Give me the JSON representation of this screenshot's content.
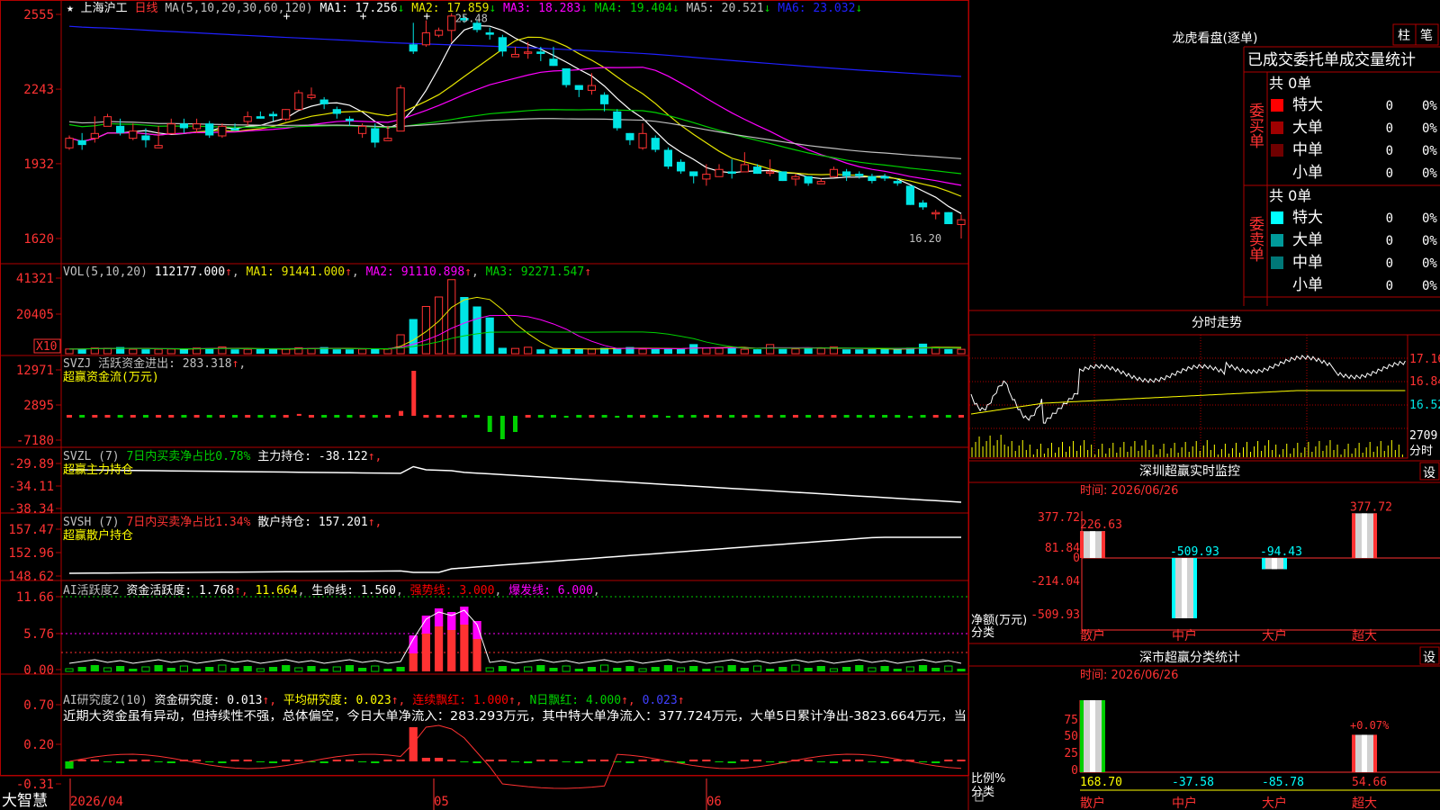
{
  "colors": {
    "bg": "#000000",
    "grid": "#b00000",
    "up": "#ff3232",
    "down": "#00e5e5",
    "green": "#00d000",
    "ma1": "#ffffff",
    "ma2": "#e6e600",
    "ma3": "#ff00ff",
    "ma4": "#00d000",
    "ma5": "#c0c0c0",
    "ma6": "#2020ff",
    "label": "#c0c0c0",
    "yellow": "#ffff00",
    "red": "#ff0000",
    "magenta": "#ff00ff",
    "cyan": "#00ffff"
  },
  "main": {
    "stock_name": "上海沪工",
    "period": "日线",
    "ma_params": "MA(5,10,20,30,60,120)",
    "ma_values": [
      {
        "label": "MA1: 17.256",
        "arrow": "↓"
      },
      {
        "label": "MA2: 17.859",
        "arrow": "↓"
      },
      {
        "label": "MA3: 18.283",
        "arrow": "↓"
      },
      {
        "label": "MA4: 19.404",
        "arrow": "↓"
      },
      {
        "label": "MA5: 20.521",
        "arrow": "↓"
      },
      {
        "label": "MA6: 23.032",
        "arrow": "↓"
      }
    ],
    "y_ticks": [
      "2555",
      "2243",
      "1932",
      "1620"
    ],
    "high_marker": "25.48",
    "low_marker": "16.20"
  },
  "vol": {
    "header": "VOL(5,10,20)",
    "value": "112177.000",
    "ma": [
      {
        "label": "MA1: 91441.000"
      },
      {
        "label": "MA2: 91110.898"
      },
      {
        "label": "MA3: 92271.547"
      }
    ],
    "y_ticks": [
      "41321",
      "20405"
    ],
    "unit": "X10"
  },
  "svzj": {
    "header": "SVZJ",
    "item": "活跃资金进出: 283.318",
    "sub": "超赢资金流(万元)",
    "y_ticks": [
      "12971",
      "2895",
      "-7180"
    ]
  },
  "svzl": {
    "header": "SVZL (7)",
    "ratio": "7日内买卖净占比0.78%",
    "item": "主力持仓: -38.122",
    "sub": "超赢主力持仓",
    "y_ticks": [
      "-29.89",
      "-34.11",
      "-38.34"
    ]
  },
  "svsh": {
    "header": "SVSH (7)",
    "ratio": "7日内买卖净占比1.34%",
    "item": "散户持仓: 157.201",
    "sub": "超赢散户持仓",
    "y_ticks": [
      "157.47",
      "152.96",
      "148.62"
    ]
  },
  "ai_active": {
    "header": "AI活跃度2",
    "item1": "资金活跃度: 1.768",
    "item2": "11.664",
    "item3": "生命线: 1.560",
    "item4": "强势线: 3.000",
    "item5": "爆发线: 6.000",
    "y_ticks": [
      "11.66",
      "5.76",
      "0.00"
    ]
  },
  "ai_research": {
    "header": "AI研究度2(10)",
    "item1": "资金研究度: 0.013",
    "item2": "平均研究度: 0.023",
    "item3": "连续飘红: 1.000",
    "item4": "N日飘红: 4.000",
    "item5": "0.023",
    "comment": "近期大资金虽有异动，但持续性不强，总体偏空，今日大单净流入：283.293万元，其中特大单净流入：377.724万元，大单5日累计净出-3823.664万元，当",
    "y_ticks": [
      "0.70",
      "0.20",
      "-0.31"
    ]
  },
  "footer": {
    "brand": "大智慧",
    "dates": [
      "2026/04",
      "05",
      "06"
    ]
  },
  "right_panel": {
    "title": "龙虎看盘(逐单)",
    "btn_zhu": "柱",
    "btn_bi": "笔",
    "table_title": "已成交委托单成交量统计",
    "buy_label": "委买单",
    "sell_label": "委卖单",
    "buy_total": "共 0单",
    "sell_total": "共 0单",
    "buy_rows": [
      {
        "name": "特大",
        "count": "0",
        "pct": "0%",
        "color": "#ff0000"
      },
      {
        "name": "大单",
        "count": "0",
        "pct": "0%",
        "color": "#a00000"
      },
      {
        "name": "中单",
        "count": "0",
        "pct": "0%",
        "color": "#700000"
      },
      {
        "name": "小单",
        "count": "0",
        "pct": "0%",
        "color": ""
      }
    ],
    "sell_rows": [
      {
        "name": "特大",
        "count": "0",
        "pct": "0%",
        "color": "#00ffff"
      },
      {
        "name": "大单",
        "count": "0",
        "pct": "0%",
        "color": "#009a9a"
      },
      {
        "name": "中单",
        "count": "0",
        "pct": "0%",
        "color": "#007878"
      },
      {
        "name": "小单",
        "count": "0",
        "pct": "0%",
        "color": ""
      }
    ],
    "intraday_title": "分时走势",
    "intraday_ticks": [
      "17.16",
      "16.84",
      "16.52"
    ],
    "intraday_vol": "2709",
    "intraday_vol_label": "分时",
    "monitor_title": "深圳超赢实时监控",
    "monitor_set": "设",
    "monitor_time": "时间: 2026/06/26",
    "monitor_y": [
      "377.72",
      "81.84",
      "0",
      "-214.04",
      "-509.93"
    ],
    "monitor_ylabel1": "净额(万元)",
    "monitor_ylabel2": "分类",
    "monitor_cats": [
      "散户",
      "中户",
      "大户",
      "超大"
    ],
    "monitor_vals": [
      "226.63",
      "-509.93",
      "-94.43",
      "377.72"
    ],
    "stat_title": "深市超赢分类统计",
    "stat_set": "设",
    "stat_time": "时间: 2026/06/26",
    "stat_y": [
      "75",
      "50",
      "25",
      "0"
    ],
    "stat_ylabel1": "比例%",
    "stat_ylabel2": "分类",
    "stat_cats": [
      "散户",
      "中户",
      "大户",
      "超大"
    ],
    "stat_vals": [
      "168.70",
      "-37.58",
      "-85.78",
      "54.66"
    ],
    "stat_top_label": "+0.07%"
  },
  "chart_data": {
    "type": "candlestick",
    "candles": [
      [
        20.0,
        20.4,
        20.5,
        19.9
      ],
      [
        20.3,
        20.1,
        20.6,
        19.9
      ],
      [
        20.4,
        20.6,
        21.3,
        20.2
      ],
      [
        20.9,
        21.3,
        21.4,
        20.9
      ],
      [
        20.9,
        20.6,
        21.2,
        20.5
      ],
      [
        20.4,
        20.7,
        21.0,
        20.3
      ],
      [
        20.5,
        20.3,
        20.8,
        20.0
      ],
      [
        20.0,
        20.1,
        20.9,
        20.0
      ],
      [
        20.6,
        21.0,
        21.2,
        20.6
      ],
      [
        21.0,
        20.8,
        21.2,
        20.6
      ],
      [
        20.8,
        21.0,
        21.2,
        20.6
      ],
      [
        21.0,
        20.5,
        21.1,
        20.4
      ],
      [
        20.5,
        20.9,
        21.0,
        20.4
      ],
      [
        20.8,
        20.7,
        21.0,
        20.7
      ],
      [
        21.1,
        21.3,
        21.5,
        20.9
      ],
      [
        21.3,
        21.2,
        21.5,
        21.2
      ],
      [
        21.4,
        21.3,
        21.5,
        21.1
      ],
      [
        21.2,
        21.6,
        21.6,
        21.1
      ],
      [
        21.6,
        22.3,
        22.4,
        21.6
      ],
      [
        22.1,
        22.2,
        22.5,
        22.0
      ],
      [
        22.0,
        21.8,
        22.1,
        21.6
      ],
      [
        21.6,
        21.4,
        21.7,
        21.2
      ],
      [
        21.2,
        21.1,
        21.3,
        20.9
      ],
      [
        20.6,
        20.9,
        21.0,
        20.4
      ],
      [
        20.8,
        20.2,
        21.0,
        20.0
      ],
      [
        20.3,
        20.4,
        20.9,
        20.3
      ],
      [
        20.7,
        22.5,
        22.6,
        20.7
      ],
      [
        24.3,
        24.0,
        25.2,
        23.9
      ],
      [
        24.3,
        24.8,
        25.3,
        24.2
      ],
      [
        24.7,
        24.9,
        25.0,
        24.6
      ],
      [
        24.9,
        25.5,
        25.6,
        24.4
      ],
      [
        25.4,
        25.3,
        25.5,
        25.2
      ],
      [
        25.2,
        24.9,
        25.3,
        24.8
      ],
      [
        24.8,
        24.7,
        25.0,
        24.5
      ],
      [
        24.6,
        24.0,
        24.7,
        23.8
      ],
      [
        23.8,
        23.9,
        24.2,
        23.8
      ],
      [
        24.0,
        24.0,
        24.4,
        23.7
      ],
      [
        24.0,
        23.9,
        24.2,
        23.6
      ],
      [
        23.7,
        23.4,
        24.2,
        23.4
      ],
      [
        23.3,
        22.6,
        23.3,
        22.5
      ],
      [
        22.6,
        22.4,
        22.6,
        22.1
      ],
      [
        22.4,
        22.6,
        23.1,
        22.2
      ],
      [
        22.2,
        21.8,
        22.3,
        21.5
      ],
      [
        21.5,
        20.8,
        21.6,
        20.7
      ],
      [
        20.6,
        20.3,
        20.6,
        20.1
      ],
      [
        20.0,
        20.6,
        21.0,
        19.9
      ],
      [
        20.4,
        19.9,
        20.5,
        19.8
      ],
      [
        19.9,
        19.2,
        20.0,
        19.1
      ],
      [
        19.4,
        19.0,
        19.5,
        18.9
      ],
      [
        19.0,
        18.8,
        19.0,
        18.5
      ],
      [
        18.7,
        18.9,
        19.3,
        18.4
      ],
      [
        18.8,
        19.1,
        19.3,
        18.8
      ],
      [
        19.0,
        18.9,
        19.5,
        18.7
      ],
      [
        19.0,
        19.3,
        19.8,
        19.0
      ],
      [
        19.2,
        18.9,
        19.3,
        18.9
      ],
      [
        19.0,
        19.0,
        19.5,
        18.8
      ],
      [
        19.0,
        18.6,
        19.0,
        18.6
      ],
      [
        18.7,
        18.8,
        18.9,
        18.4
      ],
      [
        18.8,
        18.5,
        18.8,
        18.4
      ],
      [
        18.5,
        18.6,
        18.7,
        18.5
      ],
      [
        18.8,
        19.1,
        19.2,
        18.8
      ],
      [
        19.0,
        18.8,
        19.1,
        18.6
      ],
      [
        18.9,
        18.8,
        19.0,
        18.7
      ],
      [
        18.8,
        18.6,
        18.9,
        18.5
      ],
      [
        18.8,
        18.7,
        18.9,
        18.6
      ],
      [
        18.6,
        18.5,
        18.7,
        18.4
      ],
      [
        18.4,
        17.6,
        18.4,
        17.6
      ],
      [
        17.7,
        17.5,
        17.8,
        17.4
      ],
      [
        17.3,
        17.3,
        17.4,
        17.0
      ],
      [
        17.3,
        16.8,
        17.3,
        16.8
      ],
      [
        16.8,
        17.0,
        17.2,
        16.2
      ]
    ],
    "ylim": [
      16.2,
      25.55
    ]
  }
}
